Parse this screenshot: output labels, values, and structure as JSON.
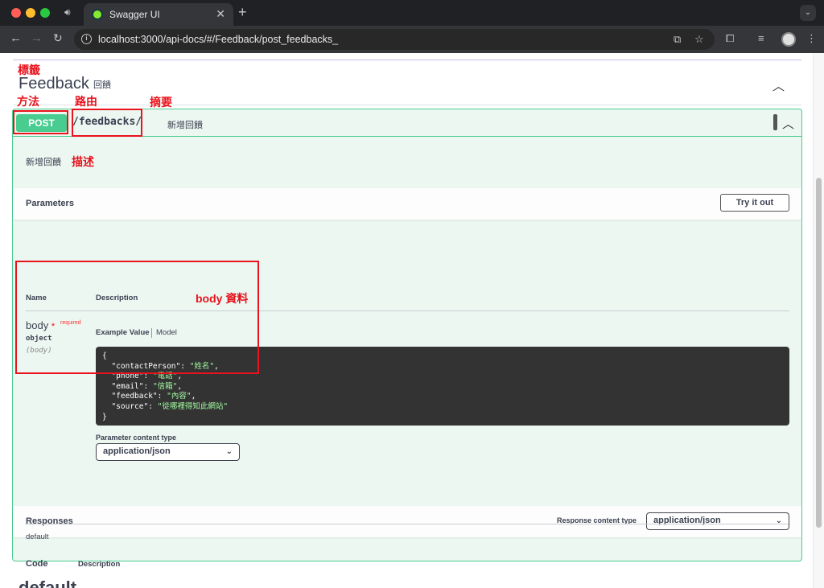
{
  "browser": {
    "tab_title": "Swagger UI",
    "url": "localhost:3000/api-docs/#/Feedback/post_feedbacks_"
  },
  "annotations": {
    "tag": "標籤",
    "method": "方法",
    "route": "路由",
    "summary": "摘要",
    "description": "描述",
    "body": "body 資料"
  },
  "tag": {
    "name": "Feedback",
    "description": "回饋"
  },
  "operation": {
    "method": "POST",
    "path": "/feedbacks/",
    "summary": "新增回饋",
    "description": "新增回饋"
  },
  "parameters": {
    "title": "Parameters",
    "try_button": "Try it out",
    "col_name": "Name",
    "col_description": "Description",
    "name": "body",
    "star": "*",
    "required": "required",
    "type": "object",
    "in": "(body)",
    "example_tab": "Example Value",
    "model_tab": "Model",
    "example_json": {
      "line_open": "{",
      "k1": "\"contactPerson\"",
      "v1": "\"姓名\"",
      "k2": "\"phone\"",
      "v2": "\"電話\"",
      "k3": "\"email\"",
      "v3": "\"信箱\"",
      "k4": "\"feedback\"",
      "v4": "\"內容\"",
      "k5": "\"source\"",
      "v5": "\"從哪裡得知此網站\"",
      "line_close": "}"
    },
    "content_type_label": "Parameter content type",
    "content_type_value": "application/json"
  },
  "responses": {
    "title": "Responses",
    "content_type_label": "Response content type",
    "content_type_value": "application/json",
    "col_code": "Code",
    "col_description": "Description",
    "code": "default"
  },
  "next_tag": "default",
  "colors": {
    "post": "#49cc90",
    "annotation": "#e8131d"
  }
}
